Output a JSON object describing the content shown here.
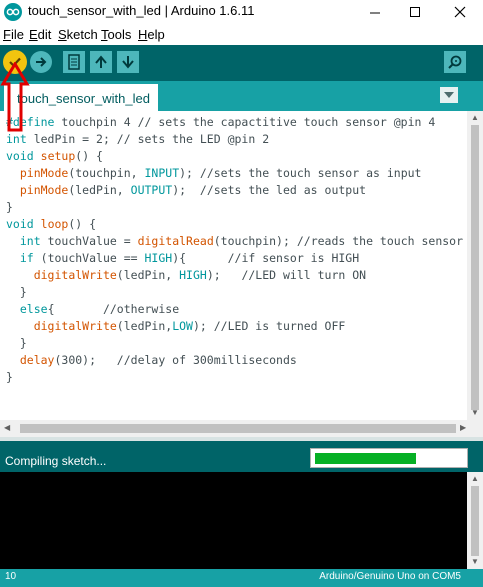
{
  "window": {
    "title": "touch_sensor_with_led | Arduino 1.6.11"
  },
  "menu": [
    {
      "label": "File",
      "mnemonic": "F",
      "rest": "ile"
    },
    {
      "label": "Edit",
      "mnemonic": "E",
      "rest": "dit"
    },
    {
      "label": "Sketch",
      "mnemonic": "S",
      "rest": "ketch"
    },
    {
      "label": "Tools",
      "mnemonic": "T",
      "rest": "ools"
    },
    {
      "label": "Help",
      "mnemonic": "H",
      "rest": "elp"
    }
  ],
  "toolbar": {
    "icons": [
      "verify-icon",
      "upload-icon",
      "new-icon",
      "open-icon",
      "save-icon",
      "serial-monitor-icon"
    ]
  },
  "tab": {
    "name": "touch_sensor_with_led"
  },
  "code": [
    "#define touchpin 4 // sets the capactitive touch sensor @pin 4",
    "int ledPin = 2; // sets the LED @pin 2",
    "void setup() {",
    "  pinMode(touchpin, INPUT); //sets the touch sensor as input",
    "  pinMode(ledPin, OUTPUT);  //sets the led as output",
    "}",
    "void loop() {",
    "  int touchValue = digitalRead(touchpin); //reads the touch sensor",
    "  if (touchValue == HIGH){      //if sensor is HIGH",
    "    digitalWrite(ledPin, HIGH);   //LED will turn ON",
    "  }",
    "  else{       //otherwise",
    "    digitalWrite(ledPin,LOW); //LED is turned OFF",
    "  }",
    "  delay(300);   //delay of 300milliseconds",
    "}"
  ],
  "status": {
    "message": "Compiling sketch...",
    "progress": 0.68
  },
  "footer": {
    "line": "10",
    "board": "Arduino/Genuino Uno on COM5"
  },
  "colors": {
    "toolbar": "#006468",
    "tabstrip": "#17a1a5",
    "verify": "#f1c40f",
    "annotation": "#e00000",
    "progress": "#06b025"
  }
}
